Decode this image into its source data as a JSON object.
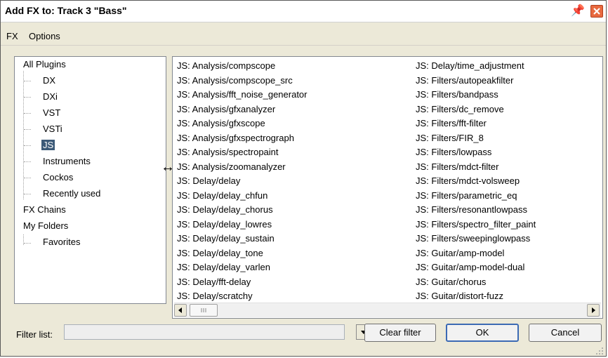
{
  "window": {
    "title": "Add FX to: Track 3 \"Bass\""
  },
  "menu": {
    "items": [
      "FX",
      "Options"
    ]
  },
  "tree": {
    "items": [
      {
        "label": "All Plugins"
      },
      {
        "label": "DX"
      },
      {
        "label": "DXi"
      },
      {
        "label": "VST"
      },
      {
        "label": "VSTi"
      },
      {
        "label": "JS"
      },
      {
        "label": "Instruments"
      },
      {
        "label": "Cockos"
      },
      {
        "label": "Recently used"
      },
      {
        "label": "FX Chains"
      },
      {
        "label": "My Folders"
      },
      {
        "label": "Favorites"
      }
    ],
    "selected": "JS"
  },
  "plugins": {
    "column1": [
      "JS: Analysis/compscope",
      "JS: Analysis/compscope_src",
      "JS: Analysis/fft_noise_generator",
      "JS: Analysis/gfxanalyzer",
      "JS: Analysis/gfxscope",
      "JS: Analysis/gfxspectrograph",
      "JS: Analysis/spectropaint",
      "JS: Analysis/zoomanalyzer",
      "JS: Delay/delay",
      "JS: Delay/delay_chfun",
      "JS: Delay/delay_chorus",
      "JS: Delay/delay_lowres",
      "JS: Delay/delay_sustain",
      "JS: Delay/delay_tone",
      "JS: Delay/delay_varlen",
      "JS: Delay/fft-delay",
      "JS: Delay/scratchy"
    ],
    "column2": [
      "JS: Delay/time_adjustment",
      "JS: Filters/autopeakfilter",
      "JS: Filters/bandpass",
      "JS: Filters/dc_remove",
      "JS: Filters/fft-filter",
      "JS: Filters/FIR_8",
      "JS: Filters/lowpass",
      "JS: Filters/mdct-filter",
      "JS: Filters/mdct-volsweep",
      "JS: Filters/parametric_eq",
      "JS: Filters/resonantlowpass",
      "JS: Filters/spectro_filter_paint",
      "JS: Filters/sweepinglowpass",
      "JS: Guitar/amp-model",
      "JS: Guitar/amp-model-dual",
      "JS: Guitar/chorus",
      "JS: Guitar/distort-fuzz"
    ]
  },
  "filter": {
    "label": "Filter list:",
    "value": ""
  },
  "buttons": {
    "clear_filter": "Clear filter",
    "ok": "OK",
    "cancel": "Cancel"
  }
}
